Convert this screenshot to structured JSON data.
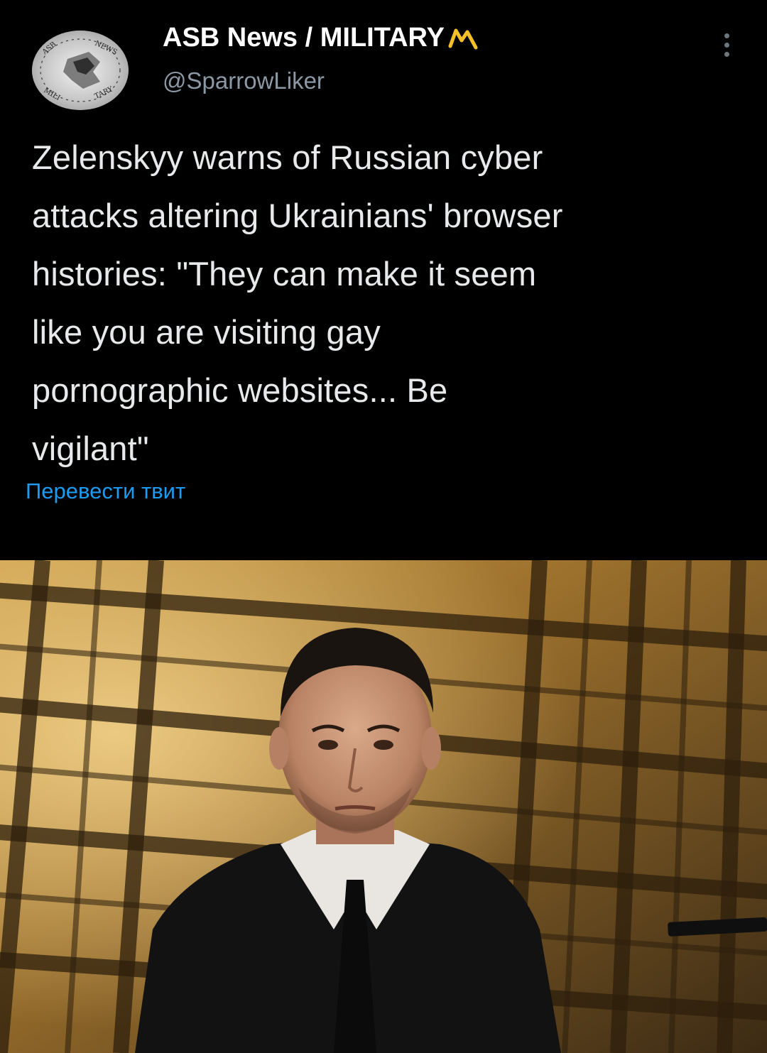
{
  "author": {
    "name": "ASB News / MILITARY",
    "handle": "@SparrowLiker",
    "avatar_icon": "asb-news-military-logo",
    "name_glyph_color": "#f4c02a"
  },
  "menu": {
    "more_icon": "more-options-icon"
  },
  "tweet": {
    "text": "Zelenskyy warns of Russian cyber\nattacks altering Ukrainians' browser\nhistories: \"They can make it seem\nlike you are visiting gay\npornographic websites... Be\nvigilant\"",
    "translate_label": "Перевести твит"
  },
  "colors": {
    "background": "#000000",
    "text": "#e7e9ea",
    "secondary": "#8b98a5",
    "link": "#1d9bf0"
  }
}
